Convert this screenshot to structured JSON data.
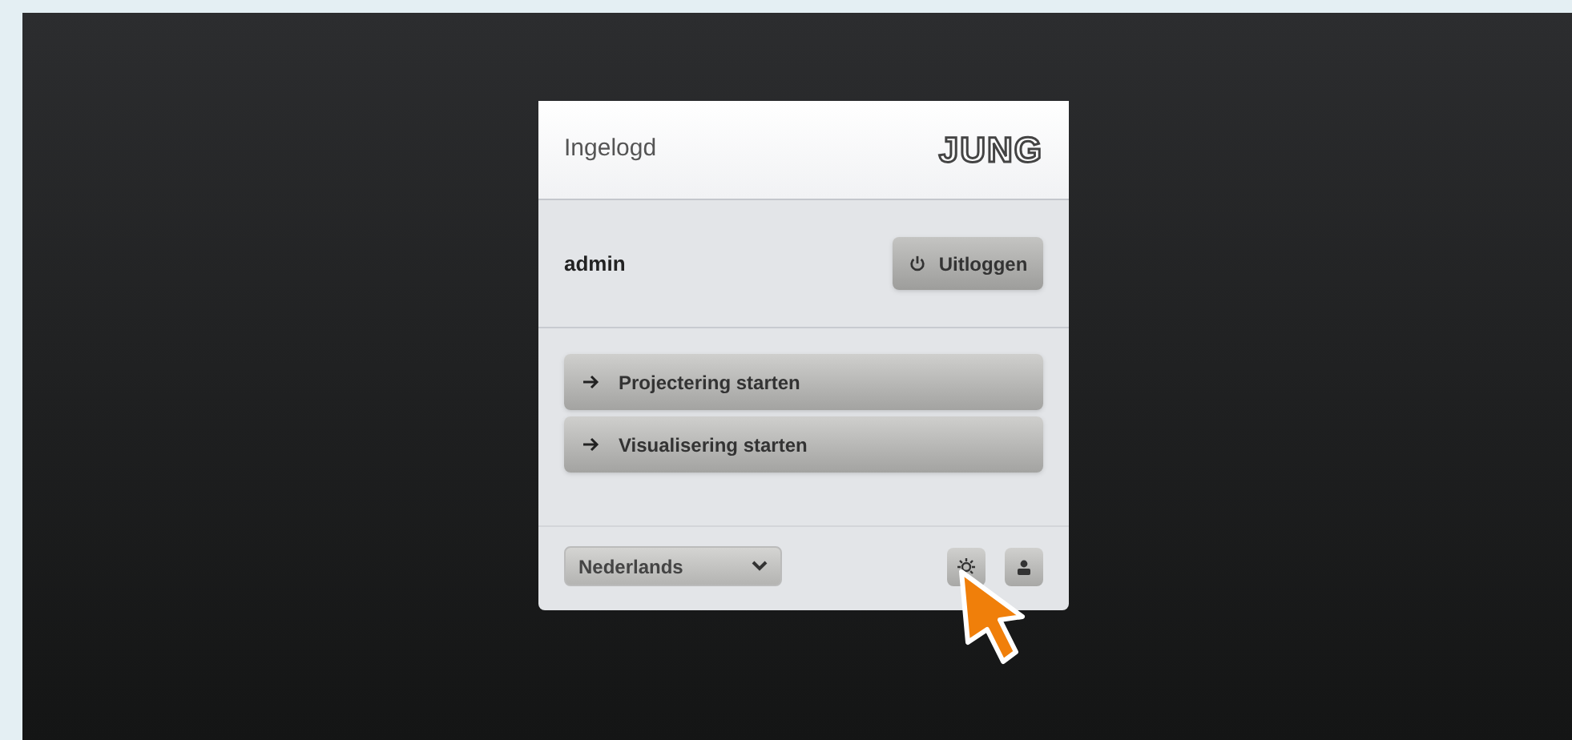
{
  "header": {
    "title": "Ingelogd",
    "logo": "JUNG"
  },
  "user": {
    "name": "admin",
    "logout_button": "Uitloggen"
  },
  "actions": [
    {
      "label": "Projectering starten"
    },
    {
      "label": "Visualisering starten"
    }
  ],
  "footer": {
    "language": "Nederlands"
  }
}
